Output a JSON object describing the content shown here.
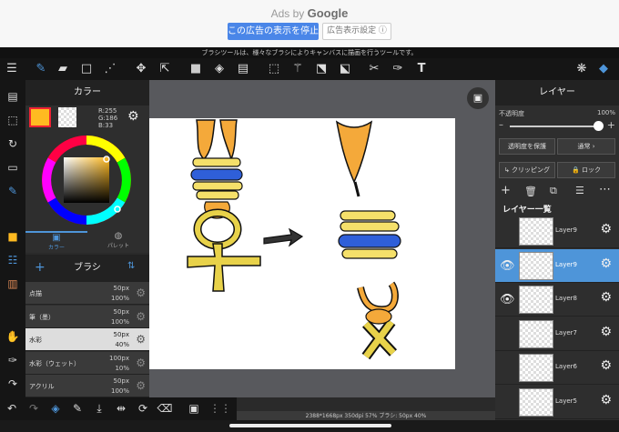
{
  "ad": {
    "label_prefix": "Ads by",
    "label_brand": "Google",
    "stop_button": "この広告の表示を停止",
    "settings_button": "広告表示設定 ⓘ"
  },
  "hint_text": "ブラシツールは、様々なブラシによりキャンバスに描画を行うツールです。",
  "color_panel": {
    "title": "カラー",
    "r": "R:255",
    "g": "G:186",
    "b": "B:33",
    "tab_color": "カラー",
    "tab_palette": "パレット",
    "colors": {
      "fore": "#ffba21",
      "accent": "#4e95d9"
    }
  },
  "brush_panel": {
    "title": "ブラシ",
    "brushes": [
      {
        "name": "点描",
        "size": "50px",
        "opacity": "100%"
      },
      {
        "name": "筆（墨）",
        "size": "50px",
        "opacity": "100%"
      },
      {
        "name": "水彩",
        "size": "50px",
        "opacity": "40%"
      },
      {
        "name": "水彩（ウェット）",
        "size": "100px",
        "opacity": "10%"
      },
      {
        "name": "アクリル",
        "size": "50px",
        "opacity": "100%"
      }
    ]
  },
  "layer_panel": {
    "title": "レイヤー",
    "opacity_label": "不透明度",
    "opacity_value": "100%",
    "protect_alpha": "透明度を保護",
    "blend_mode": "通常",
    "clipping": "クリッピング",
    "lock": "ロック",
    "list_title": "レイヤー一覧",
    "layers": [
      {
        "name": "Layer9"
      },
      {
        "name": "Layer9"
      },
      {
        "name": "Layer8"
      },
      {
        "name": "Layer7"
      },
      {
        "name": "Layer6"
      },
      {
        "name": "Layer5"
      }
    ]
  },
  "status_text": "2388*1668px 350dpi 57% ブラシ: 50px 40%"
}
